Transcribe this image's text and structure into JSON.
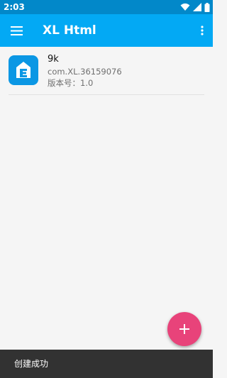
{
  "status_bar": {
    "time": "2:03",
    "icons": [
      "wifi-icon",
      "signal-icon",
      "battery-icon"
    ]
  },
  "app_bar": {
    "title": "XL Html",
    "left_icon": "menu-icon",
    "right_icon": "more-vert-icon",
    "color": "#03a9f4",
    "status_color": "#0288c9"
  },
  "list": {
    "items": [
      {
        "icon": "app-icon",
        "name": "9k",
        "package": "com.XL.36159076",
        "version_label": "版本号：",
        "version_value": "1.0"
      }
    ]
  },
  "fab": {
    "icon": "plus-icon",
    "color": "#e8437a"
  },
  "snackbar": {
    "message": "创建成功"
  }
}
